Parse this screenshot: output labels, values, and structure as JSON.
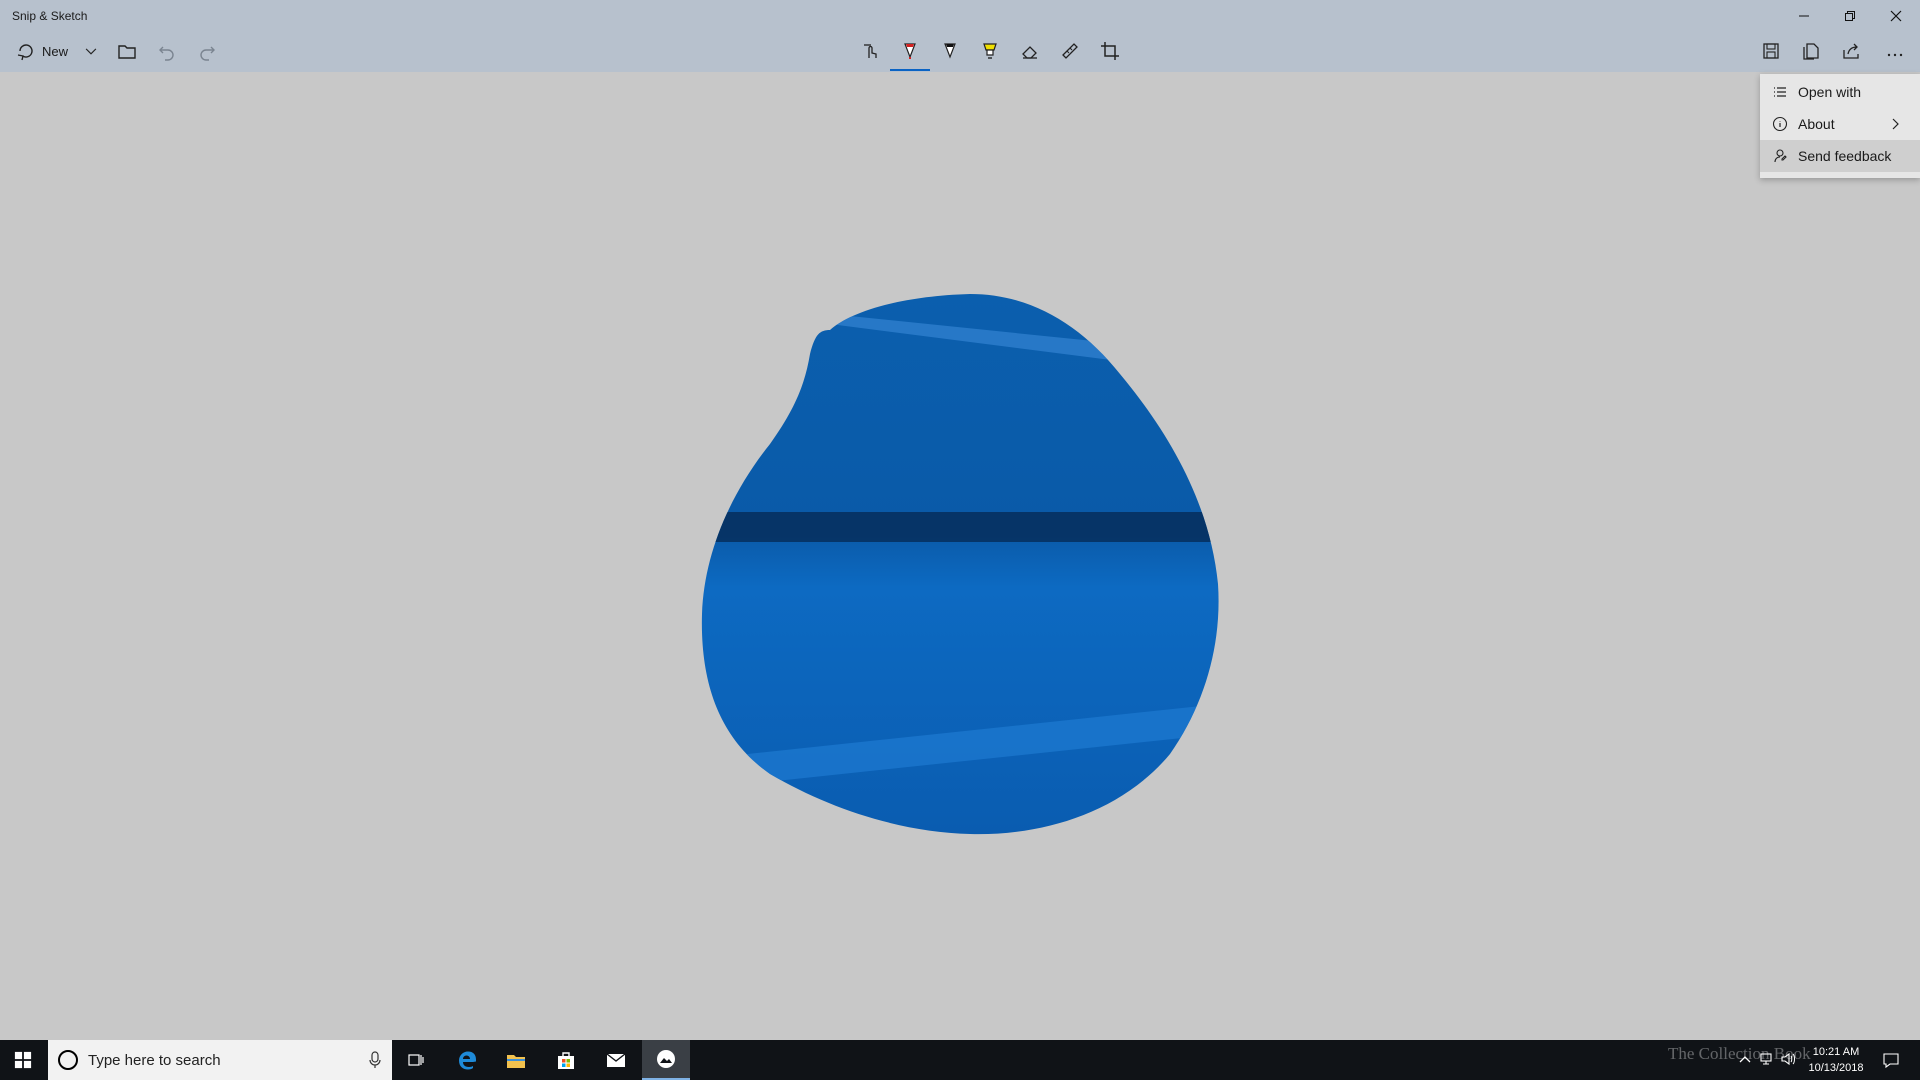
{
  "window": {
    "title": "Snip & Sketch",
    "controls": [
      "minimize-icon",
      "restore-icon",
      "close-icon"
    ]
  },
  "toolbar": {
    "new_label": "New",
    "left_icons": [
      "snip-new-icon",
      "chevron-down-icon",
      "folder-open-icon",
      "undo-icon",
      "redo-icon"
    ],
    "tools": [
      "touch-writing-icon",
      "ballpoint-pen-icon",
      "pencil-icon",
      "highlighter-icon",
      "eraser-icon",
      "ruler-icon",
      "crop-icon"
    ],
    "active_tool": "ballpoint-pen-icon",
    "right_icons": [
      "save-icon",
      "copy-icon",
      "share-icon",
      "more-icon"
    ]
  },
  "menu": {
    "items": [
      {
        "label": "Open with",
        "icon": "list-icon"
      },
      {
        "label": "About",
        "icon": "info-icon",
        "has_submenu": true
      },
      {
        "label": "Send feedback",
        "icon": "feedback-icon"
      }
    ],
    "hovered_item": "Send feedback"
  },
  "taskbar": {
    "search_placeholder": "Type here to search",
    "apps": [
      "task-view-icon",
      "edge-icon",
      "file-explorer-icon",
      "store-icon",
      "mail-icon",
      "snip-sketch-icon"
    ],
    "active_app": "snip-sketch-icon",
    "clock_time": "10:21 AM",
    "clock_date": "10/13/2018",
    "watermark": "The Collection Book"
  },
  "colors": {
    "titlebar": "#b7c1cd",
    "canvas": "#c8c8c8",
    "accent": "#0a63c4",
    "taskbar": "#101317"
  }
}
